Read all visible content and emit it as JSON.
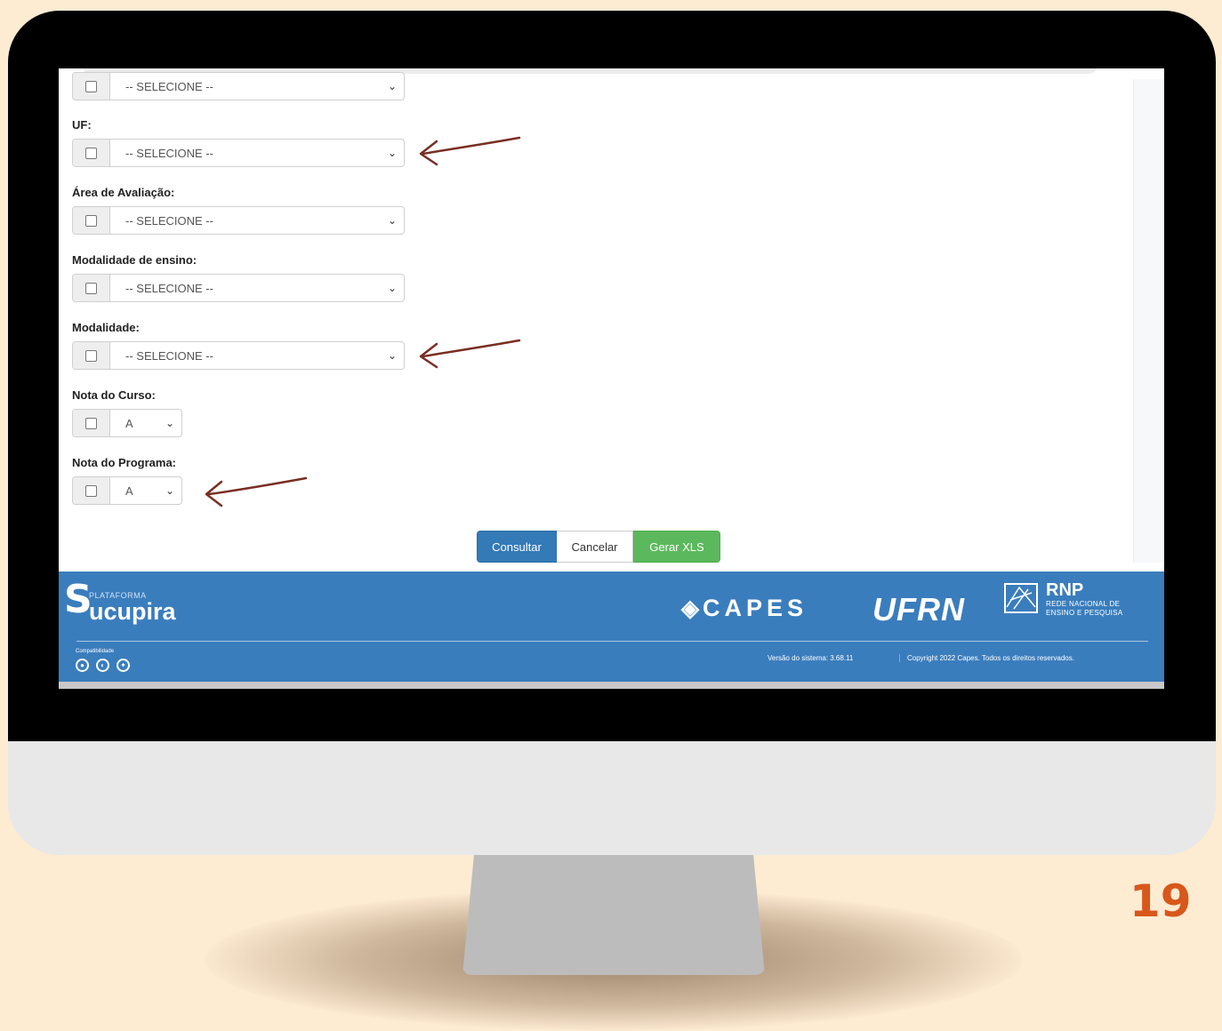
{
  "form": {
    "fields": [
      {
        "label": "",
        "value": "-- SELECIONE --"
      },
      {
        "label": "UF:",
        "value": "-- SELECIONE --"
      },
      {
        "label": "Área de Avaliação:",
        "value": "-- SELECIONE --"
      },
      {
        "label": "Modalidade de ensino:",
        "value": "-- SELECIONE --"
      },
      {
        "label": "Modalidade:",
        "value": "-- SELECIONE --"
      },
      {
        "label": "Nota do Curso:",
        "value": "A"
      },
      {
        "label": "Nota do Programa:",
        "value": "A"
      }
    ],
    "buttons": {
      "consultar": "Consultar",
      "cancelar": "Cancelar",
      "gerar_xls": "Gerar XLS"
    }
  },
  "footer": {
    "logo_small": "PLATAFORMA",
    "logo_initial": "S",
    "logo_name": "ucupira",
    "capes": "CAPES",
    "ufrn": "UFRN",
    "rnp_title": "RNP",
    "rnp_sub1": "REDE NACIONAL DE",
    "rnp_sub2": "ENSINO E PESQUISA",
    "compat_label": "Compatibilidade",
    "compat_icons": [
      "chrome-icon",
      "firefox-icon",
      "safari-icon"
    ],
    "version": "Versão do sistema: 3.68.11",
    "copyright": "Copyright 2022 Capes. Todos os direitos reservados."
  },
  "page_number": "19",
  "colors": {
    "background": "#fdebd2",
    "footer_blue": "#3a7dbd",
    "arrow": "#7a2e22",
    "page_number": "#d8571b"
  }
}
